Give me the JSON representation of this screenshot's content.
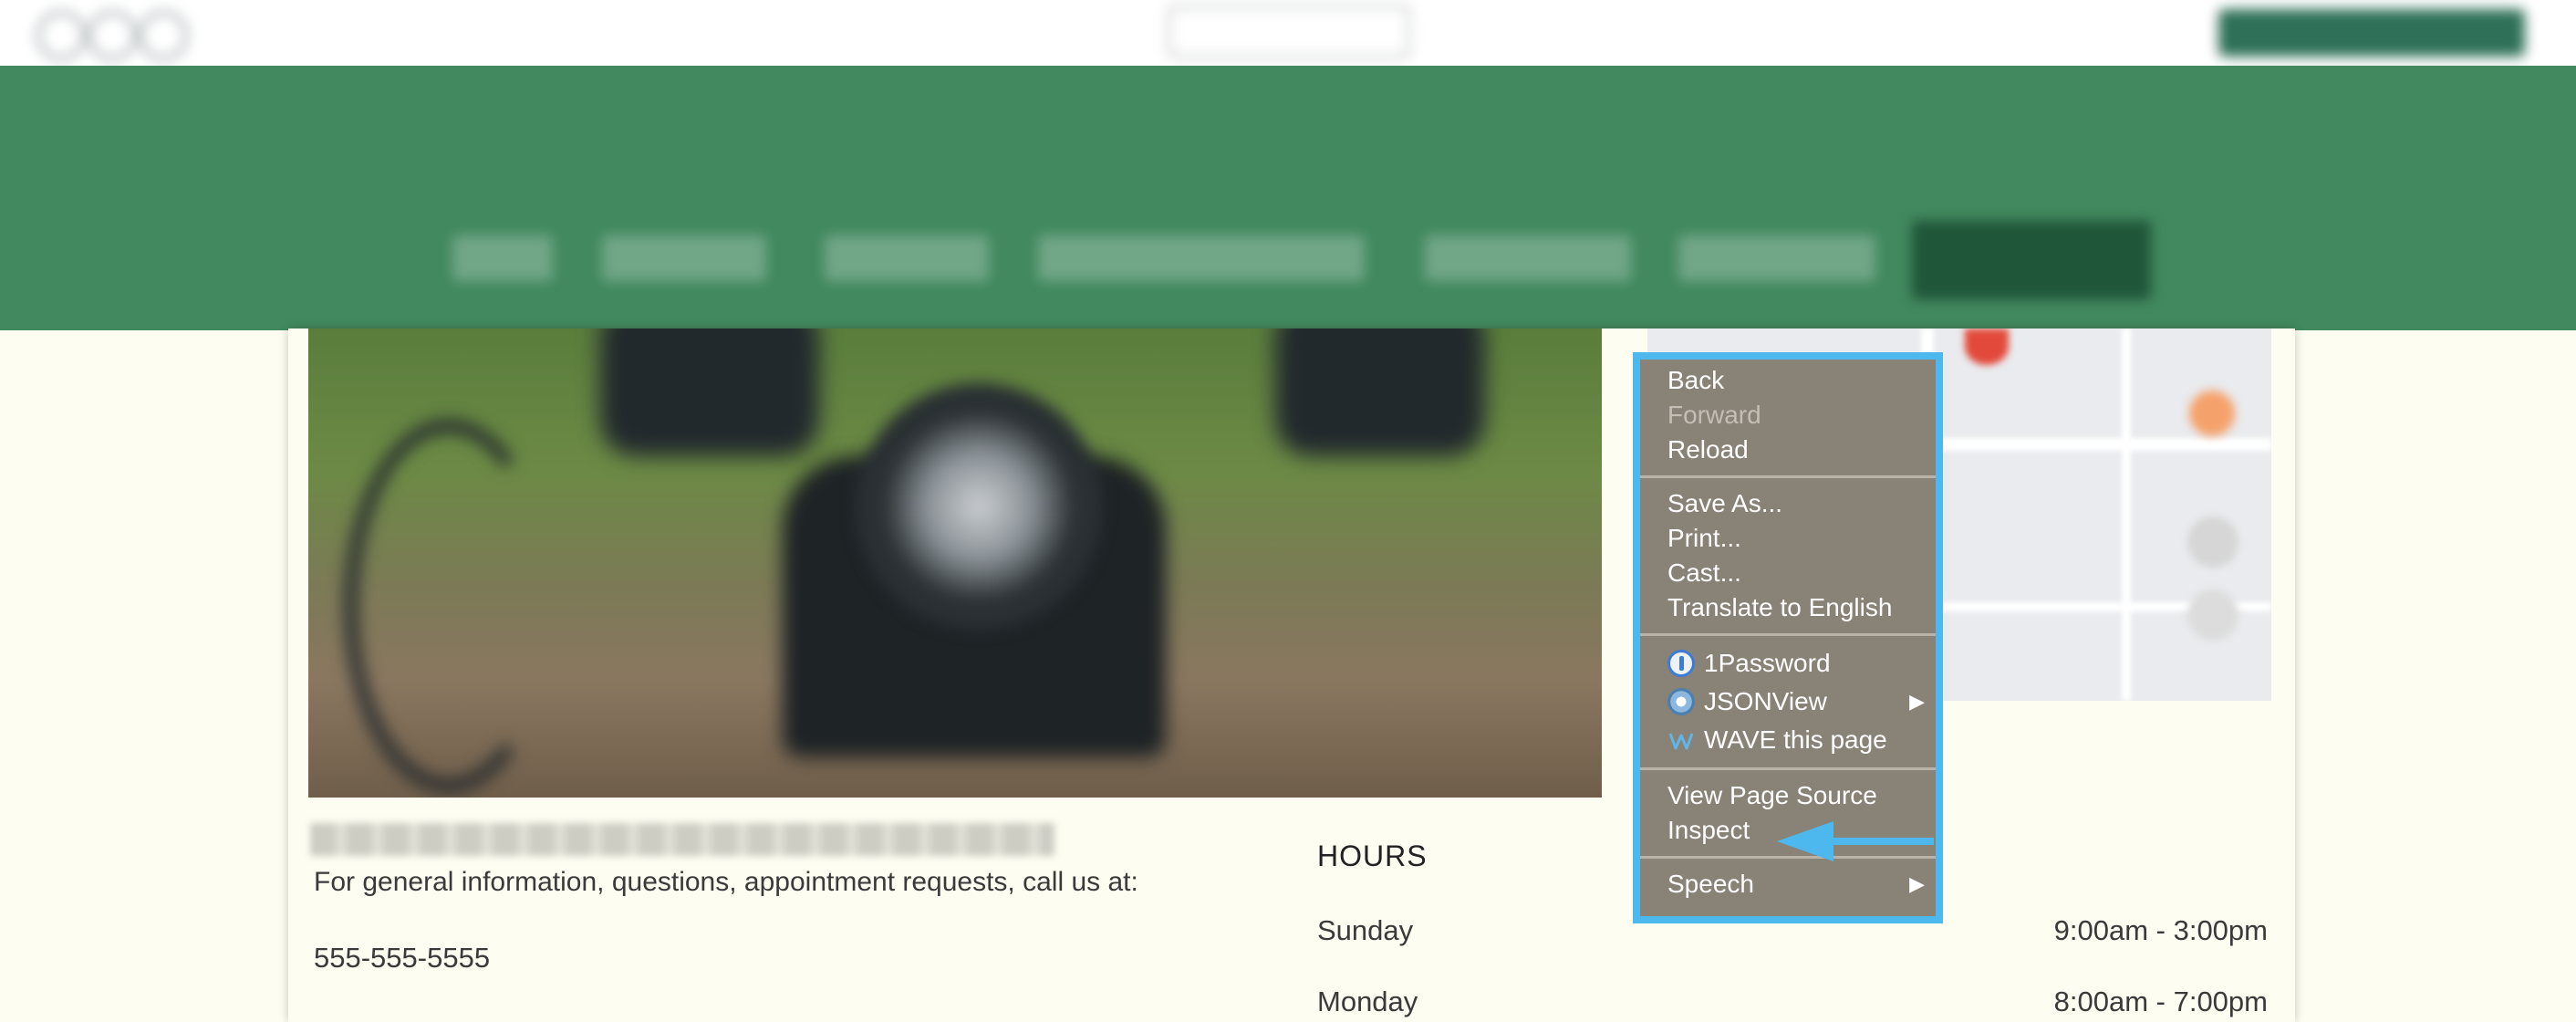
{
  "context_menu": {
    "back": "Back",
    "forward": "Forward",
    "reload": "Reload",
    "save_as": "Save As...",
    "print": "Print...",
    "cast": "Cast...",
    "translate": "Translate to English",
    "onepassword": "1Password",
    "jsonview": "JSONView",
    "wave": "WAVE this page",
    "view_source": "View Page Source",
    "inspect": "Inspect",
    "speech": "Speech",
    "submenu_glyph": "▶"
  },
  "content": {
    "info_text": "For general information, questions, appointment requests, call us at:",
    "phone": "555-555-5555",
    "hours_title": "HOURS",
    "hours": [
      {
        "day": "Sunday",
        "time": "9:00am - 3:00pm"
      },
      {
        "day": "Monday",
        "time": "8:00am - 7:00pm"
      }
    ]
  },
  "colors": {
    "nav_green": "#42895f",
    "highlight_blue": "#4db8ee",
    "menu_bg": "#898277",
    "page_bg": "#fdfdf2"
  },
  "icons": {
    "onepassword": "1password-icon",
    "jsonview": "jsonview-icon",
    "wave": "wave-icon",
    "annotation": "arrow-left-icon"
  }
}
